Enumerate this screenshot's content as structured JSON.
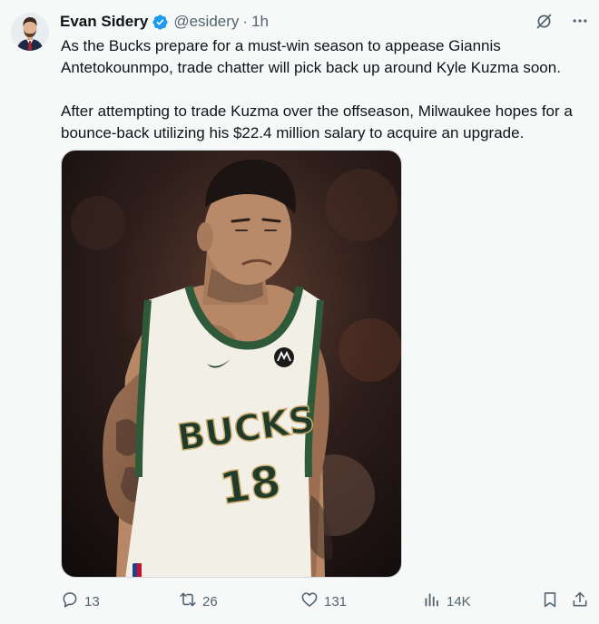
{
  "author": {
    "name": "Evan Sidery",
    "handle": "@esidery",
    "separator": "·",
    "time": "1h"
  },
  "tweet": {
    "paragraph1": "As the Bucks prepare for a must-win season to appease Giannis Antetokounmpo, trade chatter will pick back up around Kyle Kuzma soon.",
    "paragraph2": "After attempting to trade Kuzma over the offseason, Milwaukee hopes for a bounce-back utilizing his $22.4 million salary to acquire an upgrade."
  },
  "media": {
    "jersey_team": "BUCKS",
    "jersey_number": "18"
  },
  "actions": {
    "replies": "13",
    "retweets": "26",
    "likes": "131",
    "views": "14K"
  },
  "icons": {
    "verified": "verified-badge-icon",
    "grok": "grok-icon",
    "more": "more-icon",
    "reply": "reply-icon",
    "retweet": "retweet-icon",
    "like": "heart-icon",
    "views": "views-icon",
    "bookmark": "bookmark-icon",
    "share": "share-icon"
  },
  "colors": {
    "background": "#f7f9f9",
    "text": "#0f1419",
    "secondary": "#536471",
    "verified": "#1d9bf0",
    "bucks_green": "#2f5a3a"
  }
}
